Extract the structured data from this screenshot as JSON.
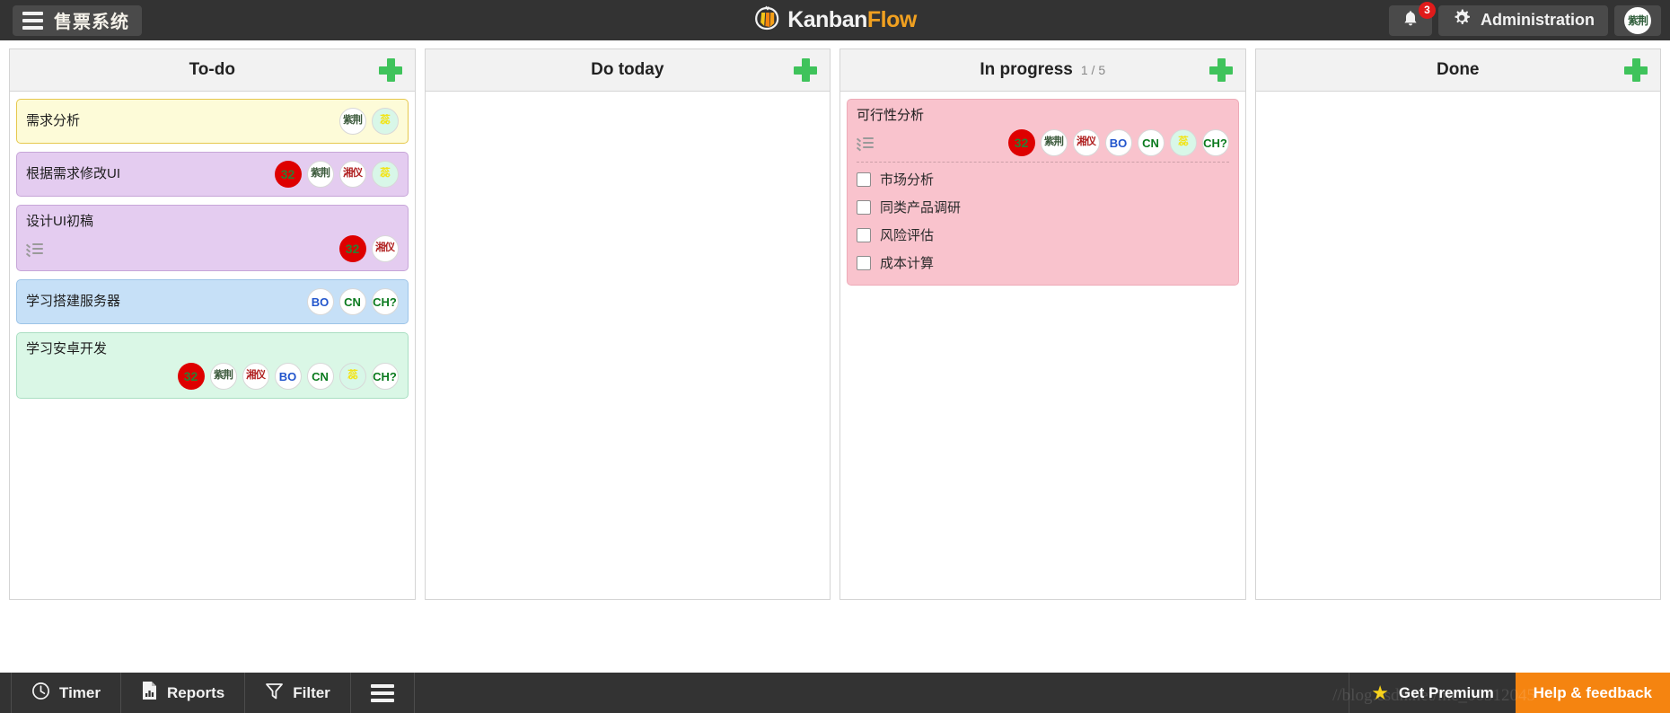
{
  "topbar": {
    "menu_icon": "hamburger-icon",
    "board_name": "售票系统",
    "logo": {
      "part1": "Kanban",
      "part2": "Flow",
      "icon": "tomato-logo-icon"
    },
    "notifications": {
      "icon": "bell-icon",
      "count": "3"
    },
    "administration": {
      "icon": "gear-icon",
      "label": "Administration"
    },
    "user": {
      "initials": "紫荆"
    }
  },
  "columns": [
    {
      "title": "To-do",
      "count": "",
      "add_label": "+",
      "cards": [
        {
          "title": "需求分析",
          "layout": "oneline",
          "bg": "#fdfbd8",
          "border": "#e6c84d",
          "pomodoro": "",
          "checklist": false,
          "avatars": [
            {
              "text": "紫荆",
              "kind": "cjk",
              "bg": "#ffffff",
              "color": "#3c5a3c"
            },
            {
              "text": "蕊",
              "kind": "cjk",
              "bg": "#d8f7e8",
              "color": "#f2e419"
            }
          ],
          "subtasks": []
        },
        {
          "title": "根据需求修改UI",
          "layout": "oneline",
          "bg": "#e4ccf0",
          "border": "#c7a6d8",
          "pomodoro": "32",
          "checklist": false,
          "avatars": [
            {
              "text": "紫荆",
              "kind": "cjk",
              "bg": "#ffffff",
              "color": "#3c5a3c"
            },
            {
              "text": "湘仪",
              "kind": "cjk",
              "bg": "#ffffff",
              "color": "#b02020"
            },
            {
              "text": "蕊",
              "kind": "cjk",
              "bg": "#d8f7e8",
              "color": "#f2e419"
            }
          ],
          "subtasks": []
        },
        {
          "title": "设计UI初稿",
          "layout": "stacked",
          "bg": "#e4ccf0",
          "border": "#c7a6d8",
          "pomodoro": "32",
          "checklist": true,
          "avatars": [
            {
              "text": "湘仪",
              "kind": "cjk",
              "bg": "#ffffff",
              "color": "#b02020"
            }
          ],
          "subtasks": []
        },
        {
          "title": "学习搭建服务器",
          "layout": "oneline",
          "bg": "#c6e0f7",
          "border": "#9dc4e8",
          "pomodoro": "",
          "checklist": false,
          "avatars": [
            {
              "text": "BO",
              "kind": "latin",
              "bg": "#ffffff",
              "color": "#2255cc"
            },
            {
              "text": "CN",
              "kind": "latin",
              "bg": "#ffffff",
              "color": "#0a7a1e"
            },
            {
              "text": "CH?",
              "kind": "latin",
              "bg": "#ffffff",
              "color": "#0a7a1e"
            }
          ],
          "subtasks": []
        },
        {
          "title": "学习安卓开发",
          "layout": "stacked",
          "bg": "#daf7e6",
          "border": "#a9dec2",
          "pomodoro": "32",
          "checklist": false,
          "avatars": [
            {
              "text": "紫荆",
              "kind": "cjk",
              "bg": "#ffffff",
              "color": "#3c5a3c"
            },
            {
              "text": "湘仪",
              "kind": "cjk",
              "bg": "#ffffff",
              "color": "#b02020"
            },
            {
              "text": "BO",
              "kind": "latin",
              "bg": "#ffffff",
              "color": "#2255cc"
            },
            {
              "text": "CN",
              "kind": "latin",
              "bg": "#ffffff",
              "color": "#0a7a1e"
            },
            {
              "text": "蕊",
              "kind": "cjk",
              "bg": "#d8f7e8",
              "color": "#f2e419"
            },
            {
              "text": "CH?",
              "kind": "latin",
              "bg": "#ffffff",
              "color": "#0a7a1e"
            }
          ],
          "subtasks": []
        }
      ]
    },
    {
      "title": "Do today",
      "count": "",
      "add_label": "+",
      "cards": []
    },
    {
      "title": "In progress",
      "count": "1 / 5",
      "add_label": "+",
      "cards": [
        {
          "title": "可行性分析",
          "layout": "stacked",
          "bg": "#f9c3cd",
          "border": "#edaab7",
          "pomodoro": "32",
          "checklist": true,
          "avatars": [
            {
              "text": "紫荆",
              "kind": "cjk",
              "bg": "#ffffff",
              "color": "#3c5a3c"
            },
            {
              "text": "湘仪",
              "kind": "cjk",
              "bg": "#ffffff",
              "color": "#b02020"
            },
            {
              "text": "BO",
              "kind": "latin",
              "bg": "#ffffff",
              "color": "#2255cc"
            },
            {
              "text": "CN",
              "kind": "latin",
              "bg": "#ffffff",
              "color": "#0a7a1e"
            },
            {
              "text": "蕊",
              "kind": "cjk",
              "bg": "#d8f7e8",
              "color": "#f2e419"
            },
            {
              "text": "CH?",
              "kind": "latin",
              "bg": "#ffffff",
              "color": "#0a7a1e"
            }
          ],
          "subtasks": [
            {
              "label": "市场分析",
              "checked": false
            },
            {
              "label": "同类产品调研",
              "checked": false
            },
            {
              "label": "风险评估",
              "checked": false
            },
            {
              "label": "成本计算",
              "checked": false
            }
          ]
        }
      ]
    },
    {
      "title": "Done",
      "count": "",
      "add_label": "+",
      "cards": []
    }
  ],
  "bottombar": {
    "items": [
      {
        "label": "Timer",
        "icon": "clock-icon"
      },
      {
        "label": "Reports",
        "icon": "report-document-icon"
      },
      {
        "label": "Filter",
        "icon": "funnel-icon"
      }
    ],
    "menu_icon": "hamburger-icon",
    "get_premium": {
      "label": "Get Premium",
      "icon": "star-icon"
    },
    "help": "Help & feedback",
    "watermark": "//blog.csdn.net/mc_00312045"
  },
  "colors": {
    "accent_green": "#3fc35b",
    "orange": "#f58410",
    "dark": "#333333",
    "badge_red": "#e01b1b",
    "pomodoro_red": "#de0000"
  }
}
